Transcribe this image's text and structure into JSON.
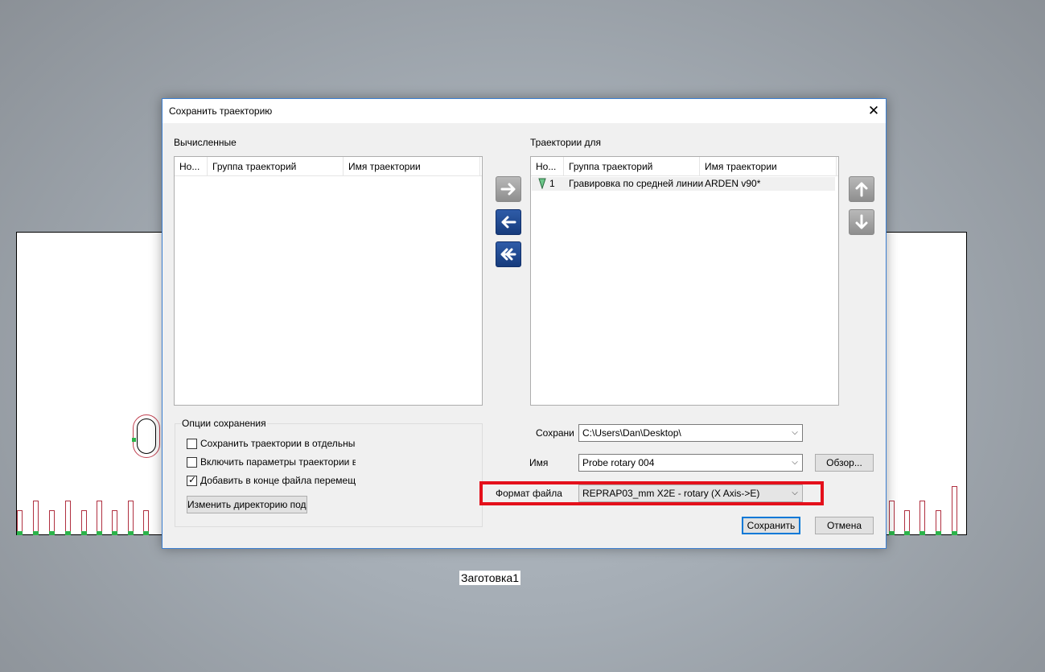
{
  "workspace": {
    "stock_label": "Заготовка1"
  },
  "dialog": {
    "title": "Сохранить траекторию",
    "close_icon": "close-icon",
    "computed": {
      "label": "Вычисленные",
      "columns": [
        "Но...",
        "Группа траекторий",
        "Имя траектории"
      ],
      "rows": []
    },
    "target": {
      "label": "Траектории для",
      "columns": [
        "Но...",
        "Группа траекторий",
        "Имя траектории"
      ],
      "rows": [
        {
          "icon": "toolpath-icon",
          "number": "1",
          "group": "Гравировка по средней линии",
          "name": "ARDEN v90*"
        }
      ]
    },
    "transfer_buttons": [
      "arrow-right-icon",
      "arrow-left-icon",
      "double-arrow-left-icon"
    ],
    "order_buttons": [
      "arrow-up-icon",
      "arrow-down-icon"
    ],
    "save_options": {
      "legend": "Опции сохранения",
      "checkboxes": [
        {
          "label": "Сохранить траектории в отдельные файлы",
          "checked": false
        },
        {
          "label": "Включить параметры траектории в файл",
          "checked": false
        },
        {
          "label": "Добавить в конце файла перемещение",
          "checked": true
        }
      ],
      "change_dir_button": "Изменить директорию подкачки"
    },
    "save_in": {
      "label": "Сохрани",
      "value": "C:\\Users\\Dan\\Desktop\\"
    },
    "name": {
      "label": "Имя",
      "value": "Probe rotary 004"
    },
    "browse_button": "Обзор...",
    "file_format": {
      "label": "Формат файла",
      "value": "REPRAP03_mm X2E - rotary (X Axis->E)"
    },
    "save_button": "Сохранить",
    "cancel_button": "Отмена",
    "colors": {
      "accent": "#0078d7",
      "highlight": "#e4101b",
      "nav_blue": "#1e4a93"
    }
  }
}
